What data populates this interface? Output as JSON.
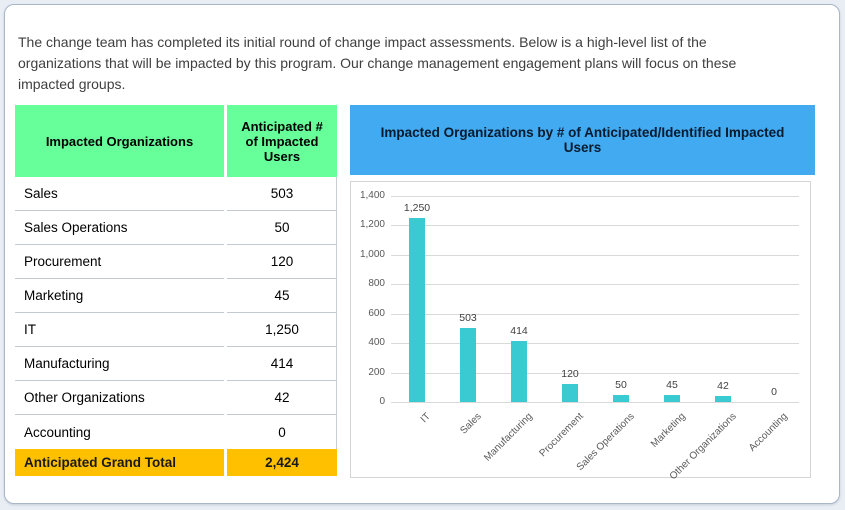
{
  "colors": {
    "green": "#66FF99",
    "gold": "#FFC000",
    "blue": "#41AAF1",
    "teal": "#3ACBD2",
    "grid": "#D9D9D9"
  },
  "page": {
    "intro_text": "The change team has completed its initial round of change impact assessments. Below is a high-level list of the organizations that will be impacted by this program. Our change management engagement plans will focus on these impacted groups."
  },
  "table": {
    "headers": [
      "Impacted Organizations",
      "Anticipated # of Impacted Users"
    ],
    "rows": [
      [
        "Sales",
        "503"
      ],
      [
        "Sales Operations",
        "50"
      ],
      [
        "Procurement",
        "120"
      ],
      [
        "Marketing",
        "45"
      ],
      [
        "IT",
        "1,250"
      ],
      [
        "Manufacturing",
        "414"
      ],
      [
        "Other Organizations",
        "42"
      ],
      [
        "Accounting",
        "0"
      ]
    ],
    "total": {
      "label": "Anticipated Grand Total",
      "value": "2,424"
    }
  },
  "chart": {
    "title": "Impacted Organizations by # of Anticipated/Identified Impacted Users"
  },
  "chart_data": {
    "type": "bar",
    "title": "Impacted Organizations by # of Anticipated/Identified Impacted Users",
    "categories": [
      "IT",
      "Sales",
      "Manufacturing",
      "Procurement",
      "Sales Operations",
      "Marketing",
      "Other Organizations",
      "Accounting"
    ],
    "values": [
      1250,
      503,
      414,
      120,
      50,
      45,
      42,
      0
    ],
    "value_labels": [
      "1,250",
      "503",
      "414",
      "120",
      "50",
      "45",
      "42",
      "0"
    ],
    "xlabel": "",
    "ylabel": "",
    "ylim": [
      0,
      1400
    ],
    "ytick_step": 200,
    "yticks": [
      "0",
      "200",
      "400",
      "600",
      "800",
      "1,000",
      "1,200",
      "1,400"
    ],
    "grid": true,
    "legend": false,
    "bar_color": "#3ACBD2"
  }
}
